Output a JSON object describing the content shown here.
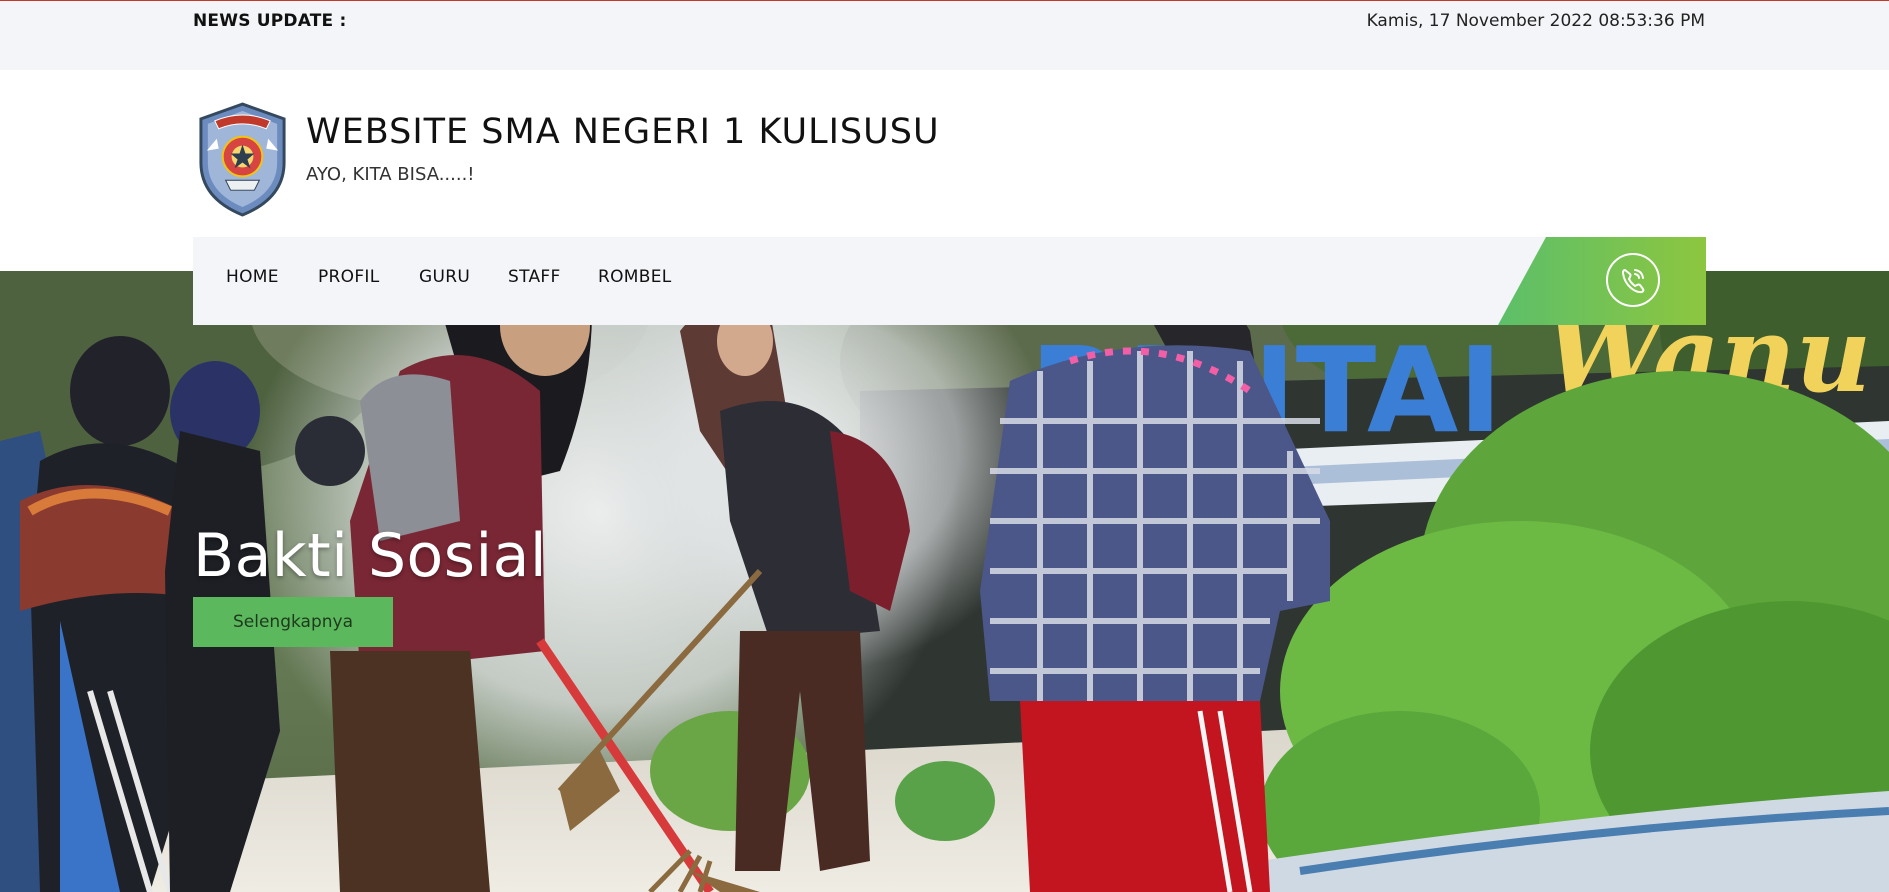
{
  "topbar": {
    "news_label": "NEWS UPDATE :",
    "datetime": "Kamis, 17 November 2022 08:53:36 PM"
  },
  "header": {
    "title": "WEBSITE SMA NEGERI 1 KULISUSU",
    "tagline": "AYO, KITA BISA.....!"
  },
  "nav": {
    "items": [
      {
        "label": "HOME"
      },
      {
        "label": "PROFIL"
      },
      {
        "label": "GURU"
      },
      {
        "label": "STAFF"
      },
      {
        "label": "ROMBEL"
      }
    ],
    "phone_icon": "phone-icon"
  },
  "hero": {
    "title": "Bakti Sosial",
    "button_label": "Selengkapnya",
    "sign_text_blue": "PANTAI",
    "sign_text_yellow": "Wanu"
  },
  "colors": {
    "accent_green": "#5cb85c",
    "nav_gradient_start": "#5cbf6a",
    "nav_gradient_end": "#8dc63f",
    "topbar_bg": "#f4f5f8",
    "top_border": "#c0392b"
  }
}
